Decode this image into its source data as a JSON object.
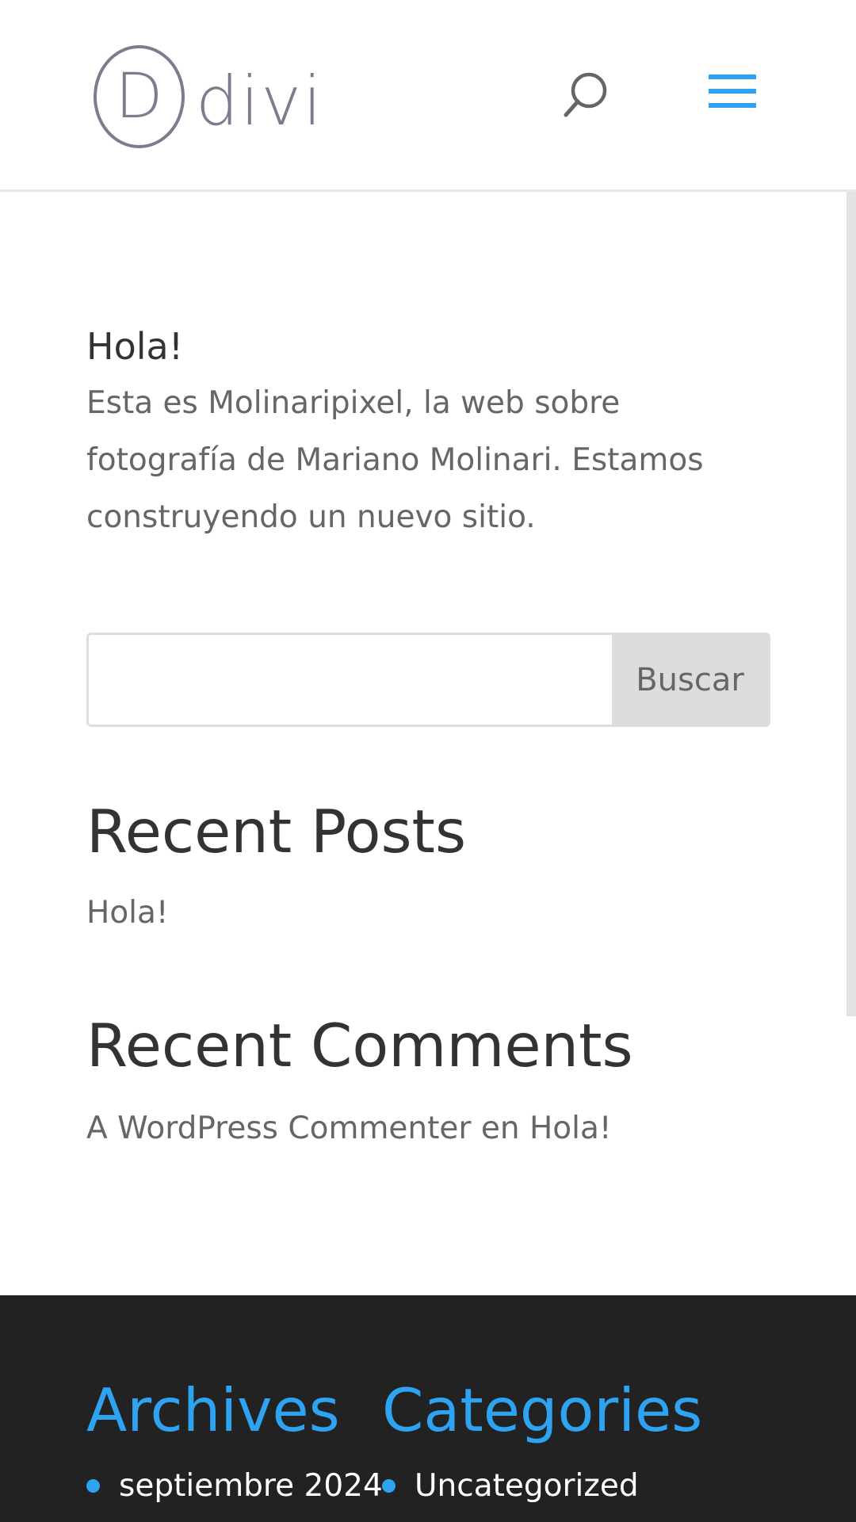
{
  "header": {
    "logo_letter": "D",
    "logo_word": "divi",
    "accent_color": "#2ea3f2",
    "logo_color": "#7b7d8f",
    "search_icon": "search-icon",
    "menu_icon": "hamburger-menu-icon"
  },
  "post": {
    "title": "Hola!",
    "text": "Esta es Molinaripixel, la web sobre fotografía de Mariano Molinari. Estamos construyendo un nuevo sitio."
  },
  "search": {
    "value": "",
    "button_label": "Buscar"
  },
  "recent_posts": {
    "title": "Recent Posts",
    "items": [
      "Hola!"
    ]
  },
  "recent_comments": {
    "title": "Recent Comments",
    "author": "A WordPress Commenter",
    "connector": " en ",
    "post": "Hola!"
  },
  "footer": {
    "background": "#222222",
    "archives": {
      "title": "Archives",
      "items": [
        "septiembre 2024"
      ]
    },
    "categories": {
      "title": "Categories",
      "items": [
        "Uncategorized"
      ]
    }
  }
}
